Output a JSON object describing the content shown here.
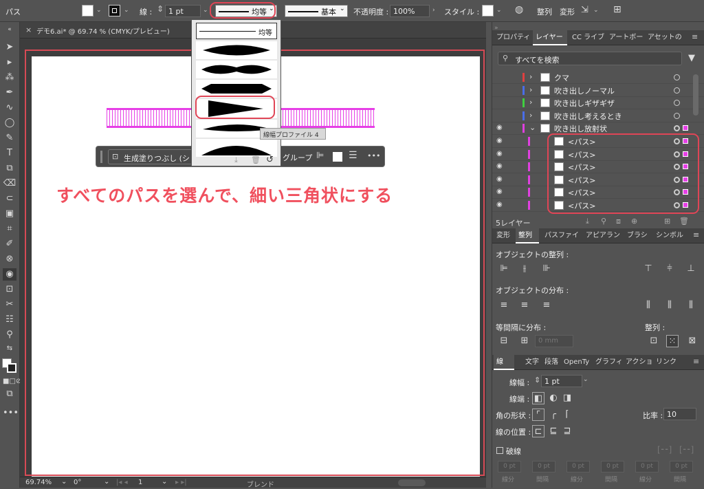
{
  "control": {
    "selection_type": "パス",
    "stroke_label": "線 :",
    "stroke_weight": "1 pt",
    "width_profile": "均等",
    "brush": "基本",
    "opacity_label": "不透明度 :",
    "opacity": "100%",
    "style_label": "スタイル :",
    "align_label": "整列",
    "transform_label": "変形"
  },
  "document_tab": {
    "title": "デモ6.ai* @ 69.74 % (CMYK/プレビュー)",
    "close": "×"
  },
  "profile_menu": {
    "selected": "均等",
    "tooltip": "線幅プロファイル 4",
    "options": [
      "均等",
      "線幅プロファイル 1",
      "線幅プロファイル 2",
      "線幅プロファイル 3",
      "線幅プロファイル 4",
      "線幅プロファイル 5",
      "線幅プロファイル 6"
    ]
  },
  "context_bar": {
    "generative_fill": "生成塗りつぶし (シ",
    "group": "グループ",
    "more": "•••"
  },
  "annotation": "すべてのパスを選んで、細い三角状にする",
  "colors": {
    "accent_red": "#e04556",
    "selection_magenta": "#e63fe6",
    "callout_text": "#f0505e"
  },
  "layers_panel": {
    "tabs": [
      "プロパティ",
      "レイヤー",
      "CC ライブ",
      "アートボー",
      "アセットの"
    ],
    "active_tab": "レイヤー",
    "search_placeholder": "すべてを検索",
    "rows": [
      {
        "name": "クマ",
        "color": "#e04040",
        "visible": false,
        "expand": "›"
      },
      {
        "name": "吹き出しノーマル",
        "color": "#4a6ee8",
        "visible": false,
        "expand": "›"
      },
      {
        "name": "吹き出しギザギザ",
        "color": "#40d040",
        "visible": false,
        "expand": "›"
      },
      {
        "name": "吹き出し考えるとき",
        "color": "#4a6ee8",
        "visible": false,
        "expand": "›"
      },
      {
        "name": "吹き出し放射状",
        "color": "#e040e0",
        "visible": true,
        "expand": "⌄"
      },
      {
        "name": "<パス>",
        "color": "#e040e0",
        "visible": true,
        "expand": ""
      },
      {
        "name": "<パス>",
        "color": "#e040e0",
        "visible": true,
        "expand": ""
      },
      {
        "name": "<パス>",
        "color": "#e040e0",
        "visible": true,
        "expand": ""
      },
      {
        "name": "<パス>",
        "color": "#e040e0",
        "visible": true,
        "expand": ""
      },
      {
        "name": "<パス>",
        "color": "#e040e0",
        "visible": true,
        "expand": ""
      },
      {
        "name": "<パス>",
        "color": "#e040e0",
        "visible": true,
        "expand": ""
      }
    ],
    "footer": "5レイヤー"
  },
  "align_panel": {
    "tabs": [
      "変形",
      "整列",
      "パスファイ",
      "アピアラン",
      "ブラシ",
      "シンボル"
    ],
    "active_tab": "整列",
    "align_objects": "オブジェクトの整列 :",
    "distribute_objects": "オブジェクトの分布 :",
    "distribute_spacing": "等間隔に分布 :",
    "align_to": "整列 :",
    "spacing_value": "0 mm"
  },
  "stroke_panel": {
    "tabs": [
      "線",
      "文字",
      "段落",
      "OpenTy",
      "グラフィ",
      "アクショ",
      "リンク"
    ],
    "active_tab": "線",
    "weight_label": "線幅 :",
    "weight": "1 pt",
    "cap_label": "線端 :",
    "corner_label": "角の形状 :",
    "limit_label": "比率 :",
    "limit": "10",
    "align_label": "線の位置 :",
    "dashed_label": "破線",
    "dash_placeholders": [
      "0 pt",
      "0 pt",
      "0 pt",
      "0 pt",
      "0 pt",
      "0 pt"
    ],
    "dash_labels": [
      "線分",
      "間隔",
      "線分",
      "間隔",
      "線分",
      "間隔"
    ]
  },
  "status_bar": {
    "zoom": "69.74%",
    "rotation": "0°",
    "artboard": "1",
    "mode": "ブレンド"
  }
}
